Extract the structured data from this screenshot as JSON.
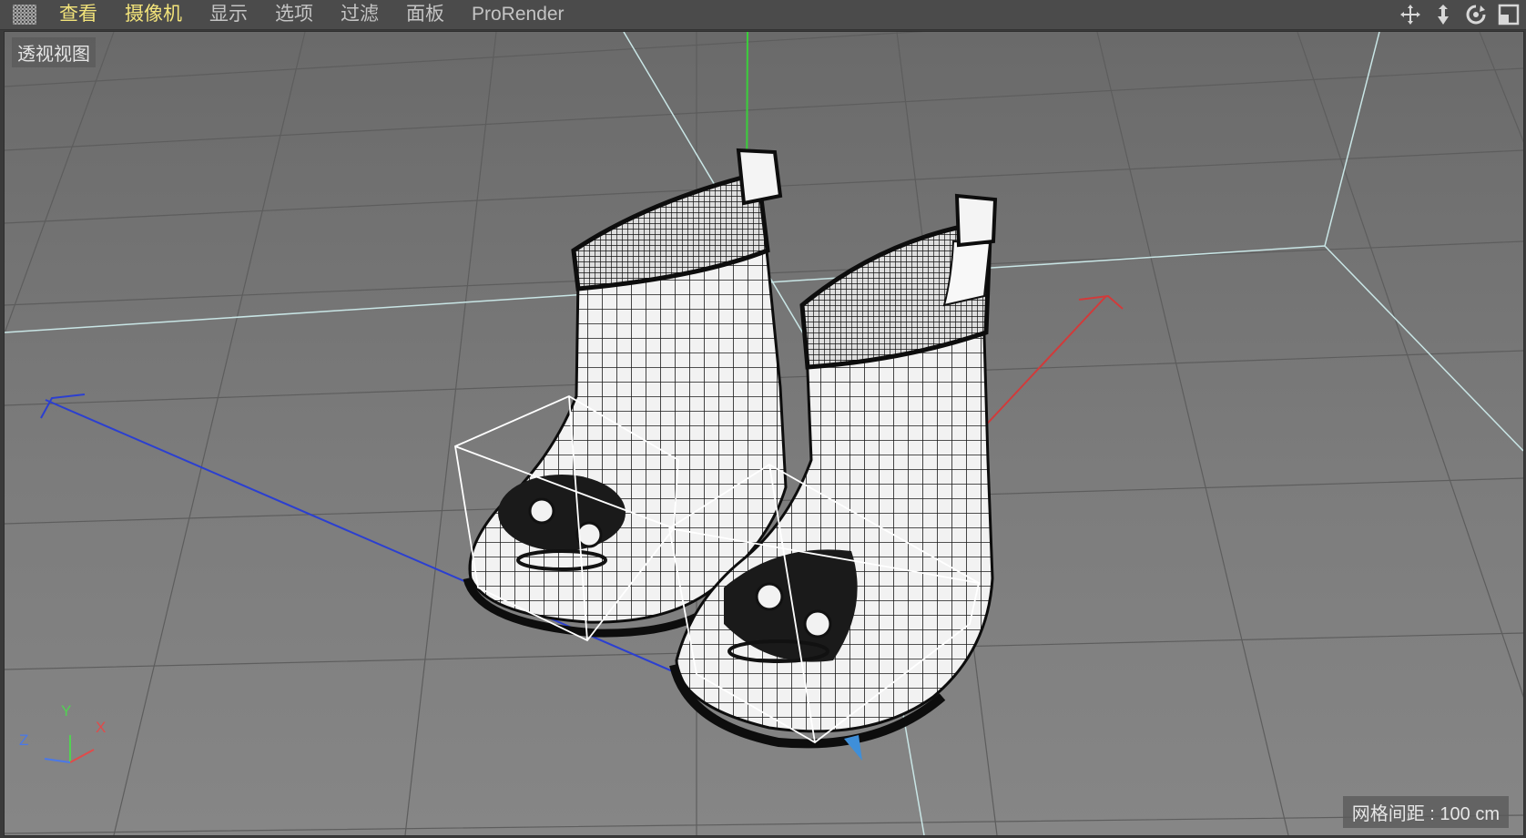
{
  "menu": {
    "items": [
      {
        "label": "查看",
        "active": true
      },
      {
        "label": "摄像机",
        "active": true
      },
      {
        "label": "显示",
        "active": false
      },
      {
        "label": "选项",
        "active": false
      },
      {
        "label": "过滤",
        "active": false
      },
      {
        "label": "面板",
        "active": false
      },
      {
        "label": "ProRender",
        "active": false
      }
    ]
  },
  "toolbar_icons": [
    "move-view-icon",
    "dolly-view-icon",
    "rotate-view-icon",
    "maximize-view-icon"
  ],
  "viewport": {
    "label": "透视视图",
    "grid_spacing": "网格间距 : 100 cm",
    "axes": {
      "x": "X",
      "y": "Y",
      "z": "Z"
    }
  },
  "colors": {
    "menu_active": "#f2e37a",
    "menu_text": "#c4c4c4",
    "axis_x": "#e24a4a",
    "axis_y": "#52d152",
    "axis_z": "#4a78e8"
  }
}
